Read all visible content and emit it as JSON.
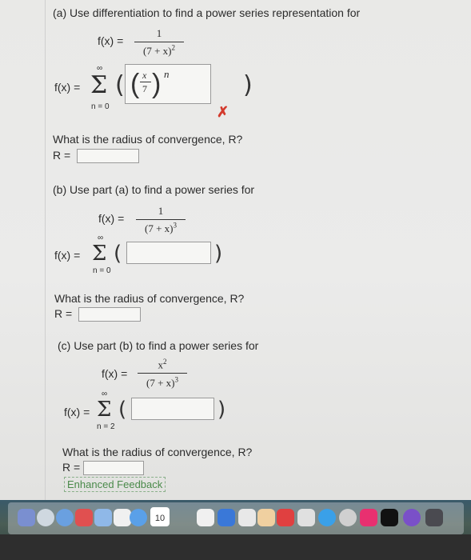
{
  "part_a": {
    "heading": "(a) Use differentiation to find a power series representation for",
    "fx_label": "f(x) =",
    "num": "1",
    "den": "(7 + x)",
    "den_exp": "2",
    "sum_lhs": "f(x) =",
    "sum_upper": "∞",
    "sum_lower": "n = 0",
    "ans_x": "x",
    "ans_7": "7",
    "ans_n": "n",
    "status": "✗",
    "radius_q": "What is the radius of convergence, R?",
    "radius_label": "R ="
  },
  "part_b": {
    "heading": "(b) Use part (a) to find a power series for",
    "fx_label": "f(x) =",
    "num": "1",
    "den": "(7 + x)",
    "den_exp": "3",
    "sum_lhs": "f(x) =",
    "sum_upper": "∞",
    "sum_lower": "n = 0",
    "radius_q": "What is the radius of convergence, R?",
    "radius_label": "R ="
  },
  "part_c": {
    "heading": "(c) Use part (b) to find a power series for",
    "fx_label": "f(x) =",
    "num": "x",
    "num_exp": "2",
    "den": "(7 + x)",
    "den_exp": "3",
    "sum_lhs": "f(x) =",
    "sum_upper": "∞",
    "sum_lower": "n = 2",
    "radius_q": "What is the radius of convergence, R?",
    "radius_label": "R ="
  },
  "feedback_label": "Enhanced Feedback",
  "dock": {
    "calendar_day": "10",
    "colors": {
      "accent": "#d33a2c",
      "green": "#4a8a4a"
    }
  }
}
